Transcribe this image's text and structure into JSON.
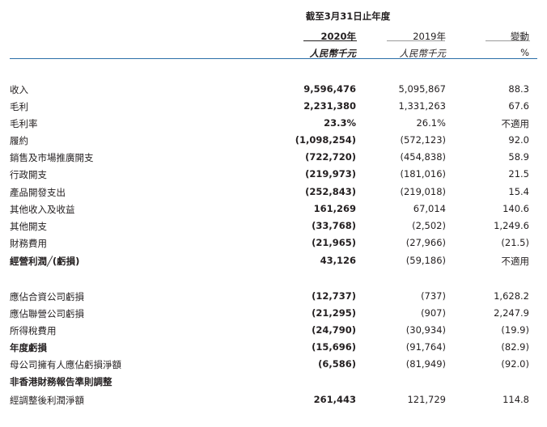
{
  "header": {
    "period": "截至3月31日止年度",
    "current_year": "2020年",
    "prior_year": "2019年",
    "change": "變動",
    "current_unit": "人民幣千元",
    "prior_unit": "人民幣千元",
    "change_unit": "%"
  },
  "rows": [
    {
      "label": "收入",
      "current": "9,596,476",
      "prior": "5,095,867",
      "change": "88.3",
      "bold": false
    },
    {
      "label": "毛利",
      "current": "2,231,380",
      "prior": "1,331,263",
      "change": "67.6",
      "bold": false
    },
    {
      "label": "毛利率",
      "current": "23.3%",
      "prior": "26.1%",
      "change": "不適用",
      "bold": false
    },
    {
      "label": "履約",
      "current": "(1,098,254)",
      "prior": "(572,123)",
      "change": "92.0",
      "bold": false
    },
    {
      "label": "銷售及市場推廣開支",
      "current": "(722,720)",
      "prior": "(454,838)",
      "change": "58.9",
      "bold": false
    },
    {
      "label": "行政開支",
      "current": "(219,973)",
      "prior": "(181,016)",
      "change": "21.5",
      "bold": false
    },
    {
      "label": "產品開發支出",
      "current": "(252,843)",
      "prior": "(219,018)",
      "change": "15.4",
      "bold": false
    },
    {
      "label": "其他收入及收益",
      "current": "161,269",
      "prior": "67,014",
      "change": "140.6",
      "bold": false
    },
    {
      "label": "其他開支",
      "current": "(33,768)",
      "prior": "(2,502)",
      "change": "1,249.6",
      "bold": false
    },
    {
      "label": "財務費用",
      "current": "(21,965)",
      "prior": "(27,966)",
      "change": "(21.5)",
      "bold": false
    },
    {
      "label": "經營利潤╱(虧損)",
      "current": "43,126",
      "prior": "(59,186)",
      "change": "不適用",
      "bold": true
    },
    {
      "label": "應佔合資公司虧損",
      "current": "(12,737)",
      "prior": "(737)",
      "change": "1,628.2",
      "bold": false
    },
    {
      "label": "應佔聯營公司虧損",
      "current": "(21,295)",
      "prior": "(907)",
      "change": "2,247.9",
      "bold": false
    },
    {
      "label": "所得稅費用",
      "current": "(24,790)",
      "prior": "(30,934)",
      "change": "(19.9)",
      "bold": false
    },
    {
      "label": "年度虧損",
      "current": "(15,696)",
      "prior": "(91,764)",
      "change": "(82.9)",
      "bold": true
    },
    {
      "label": "母公司擁有人應佔虧損淨額",
      "current": "(6,586)",
      "prior": "(81,949)",
      "change": "(92.0)",
      "bold": false
    },
    {
      "label": "非香港財務報告準則調整",
      "current": "",
      "prior": "",
      "change": "",
      "bold": true
    },
    {
      "label": "經調整後利潤淨額",
      "current": "261,443",
      "prior": "121,729",
      "change": "114.8",
      "bold": false
    }
  ]
}
